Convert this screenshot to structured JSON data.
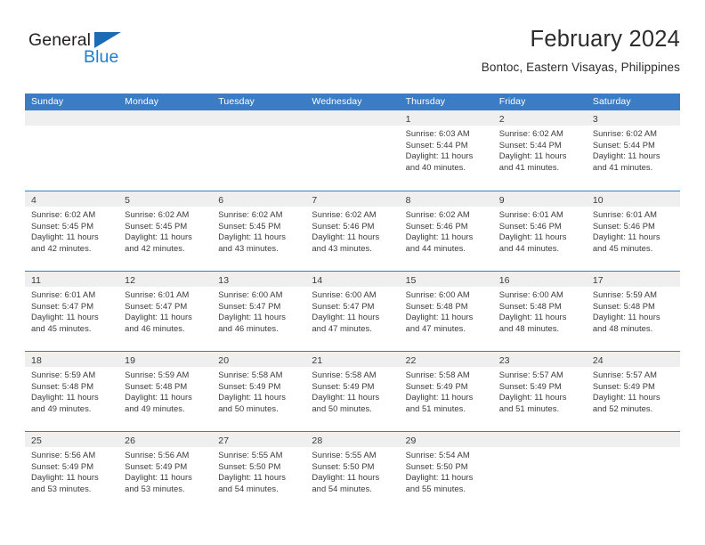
{
  "brand": {
    "name_top": "General",
    "name_bottom": "Blue",
    "triangle_color": "#1b6cb5",
    "blue_text_color": "#1b7fd4"
  },
  "header": {
    "title": "February 2024",
    "subtitle": "Bontoc, Eastern Visayas, Philippines"
  },
  "colors": {
    "header_bar": "#3b7cc4",
    "day_band": "#efefef",
    "text": "#3a3a3a",
    "page_background": "#ffffff"
  },
  "weekdays": [
    "Sunday",
    "Monday",
    "Tuesday",
    "Wednesday",
    "Thursday",
    "Friday",
    "Saturday"
  ],
  "weeks": [
    [
      {
        "day": "",
        "lines": []
      },
      {
        "day": "",
        "lines": []
      },
      {
        "day": "",
        "lines": []
      },
      {
        "day": "",
        "lines": []
      },
      {
        "day": "1",
        "lines": [
          "Sunrise: 6:03 AM",
          "Sunset: 5:44 PM",
          "Daylight: 11 hours",
          "and 40 minutes."
        ]
      },
      {
        "day": "2",
        "lines": [
          "Sunrise: 6:02 AM",
          "Sunset: 5:44 PM",
          "Daylight: 11 hours",
          "and 41 minutes."
        ]
      },
      {
        "day": "3",
        "lines": [
          "Sunrise: 6:02 AM",
          "Sunset: 5:44 PM",
          "Daylight: 11 hours",
          "and 41 minutes."
        ]
      }
    ],
    [
      {
        "day": "4",
        "lines": [
          "Sunrise: 6:02 AM",
          "Sunset: 5:45 PM",
          "Daylight: 11 hours",
          "and 42 minutes."
        ]
      },
      {
        "day": "5",
        "lines": [
          "Sunrise: 6:02 AM",
          "Sunset: 5:45 PM",
          "Daylight: 11 hours",
          "and 42 minutes."
        ]
      },
      {
        "day": "6",
        "lines": [
          "Sunrise: 6:02 AM",
          "Sunset: 5:45 PM",
          "Daylight: 11 hours",
          "and 43 minutes."
        ]
      },
      {
        "day": "7",
        "lines": [
          "Sunrise: 6:02 AM",
          "Sunset: 5:46 PM",
          "Daylight: 11 hours",
          "and 43 minutes."
        ]
      },
      {
        "day": "8",
        "lines": [
          "Sunrise: 6:02 AM",
          "Sunset: 5:46 PM",
          "Daylight: 11 hours",
          "and 44 minutes."
        ]
      },
      {
        "day": "9",
        "lines": [
          "Sunrise: 6:01 AM",
          "Sunset: 5:46 PM",
          "Daylight: 11 hours",
          "and 44 minutes."
        ]
      },
      {
        "day": "10",
        "lines": [
          "Sunrise: 6:01 AM",
          "Sunset: 5:46 PM",
          "Daylight: 11 hours",
          "and 45 minutes."
        ]
      }
    ],
    [
      {
        "day": "11",
        "lines": [
          "Sunrise: 6:01 AM",
          "Sunset: 5:47 PM",
          "Daylight: 11 hours",
          "and 45 minutes."
        ]
      },
      {
        "day": "12",
        "lines": [
          "Sunrise: 6:01 AM",
          "Sunset: 5:47 PM",
          "Daylight: 11 hours",
          "and 46 minutes."
        ]
      },
      {
        "day": "13",
        "lines": [
          "Sunrise: 6:00 AM",
          "Sunset: 5:47 PM",
          "Daylight: 11 hours",
          "and 46 minutes."
        ]
      },
      {
        "day": "14",
        "lines": [
          "Sunrise: 6:00 AM",
          "Sunset: 5:47 PM",
          "Daylight: 11 hours",
          "and 47 minutes."
        ]
      },
      {
        "day": "15",
        "lines": [
          "Sunrise: 6:00 AM",
          "Sunset: 5:48 PM",
          "Daylight: 11 hours",
          "and 47 minutes."
        ]
      },
      {
        "day": "16",
        "lines": [
          "Sunrise: 6:00 AM",
          "Sunset: 5:48 PM",
          "Daylight: 11 hours",
          "and 48 minutes."
        ]
      },
      {
        "day": "17",
        "lines": [
          "Sunrise: 5:59 AM",
          "Sunset: 5:48 PM",
          "Daylight: 11 hours",
          "and 48 minutes."
        ]
      }
    ],
    [
      {
        "day": "18",
        "lines": [
          "Sunrise: 5:59 AM",
          "Sunset: 5:48 PM",
          "Daylight: 11 hours",
          "and 49 minutes."
        ]
      },
      {
        "day": "19",
        "lines": [
          "Sunrise: 5:59 AM",
          "Sunset: 5:48 PM",
          "Daylight: 11 hours",
          "and 49 minutes."
        ]
      },
      {
        "day": "20",
        "lines": [
          "Sunrise: 5:58 AM",
          "Sunset: 5:49 PM",
          "Daylight: 11 hours",
          "and 50 minutes."
        ]
      },
      {
        "day": "21",
        "lines": [
          "Sunrise: 5:58 AM",
          "Sunset: 5:49 PM",
          "Daylight: 11 hours",
          "and 50 minutes."
        ]
      },
      {
        "day": "22",
        "lines": [
          "Sunrise: 5:58 AM",
          "Sunset: 5:49 PM",
          "Daylight: 11 hours",
          "and 51 minutes."
        ]
      },
      {
        "day": "23",
        "lines": [
          "Sunrise: 5:57 AM",
          "Sunset: 5:49 PM",
          "Daylight: 11 hours",
          "and 51 minutes."
        ]
      },
      {
        "day": "24",
        "lines": [
          "Sunrise: 5:57 AM",
          "Sunset: 5:49 PM",
          "Daylight: 11 hours",
          "and 52 minutes."
        ]
      }
    ],
    [
      {
        "day": "25",
        "lines": [
          "Sunrise: 5:56 AM",
          "Sunset: 5:49 PM",
          "Daylight: 11 hours",
          "and 53 minutes."
        ]
      },
      {
        "day": "26",
        "lines": [
          "Sunrise: 5:56 AM",
          "Sunset: 5:49 PM",
          "Daylight: 11 hours",
          "and 53 minutes."
        ]
      },
      {
        "day": "27",
        "lines": [
          "Sunrise: 5:55 AM",
          "Sunset: 5:50 PM",
          "Daylight: 11 hours",
          "and 54 minutes."
        ]
      },
      {
        "day": "28",
        "lines": [
          "Sunrise: 5:55 AM",
          "Sunset: 5:50 PM",
          "Daylight: 11 hours",
          "and 54 minutes."
        ]
      },
      {
        "day": "29",
        "lines": [
          "Sunrise: 5:54 AM",
          "Sunset: 5:50 PM",
          "Daylight: 11 hours",
          "and 55 minutes."
        ]
      },
      {
        "day": "",
        "lines": []
      },
      {
        "day": "",
        "lines": []
      }
    ]
  ]
}
